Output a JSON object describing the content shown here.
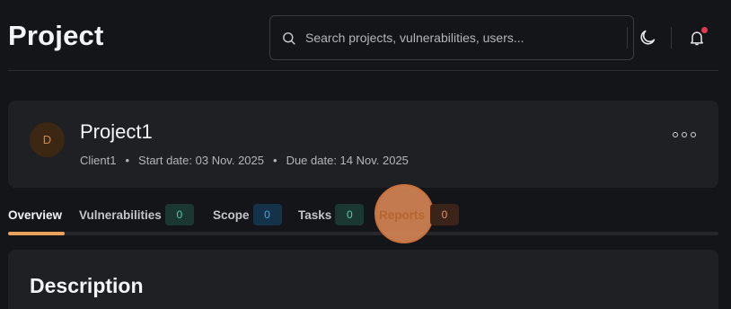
{
  "header": {
    "title": "Project",
    "search": {
      "placeholder": "Search projects, vulnerabilities, users..."
    },
    "icons": [
      "search-icon",
      "moon-icon",
      "bell-icon"
    ]
  },
  "project": {
    "avatar_initial": "D",
    "name": "Project1",
    "client": "Client1",
    "start_date": "Start date: 03 Nov. 2025",
    "due_date": "Due date: 14 Nov. 2025",
    "separator": "•"
  },
  "tabs": [
    {
      "label": "Overview",
      "active": true
    },
    {
      "label": "Vulnerabilities",
      "count": "0"
    },
    {
      "label": "Scope",
      "count": "0"
    },
    {
      "label": "Tasks",
      "count": "0"
    },
    {
      "label": "Reports",
      "count": "0"
    }
  ],
  "description": {
    "title": "Description"
  },
  "colors": {
    "background": "#141519",
    "card": "#1f2024",
    "accent": "#e9a35d",
    "notification": "#e5364b"
  }
}
